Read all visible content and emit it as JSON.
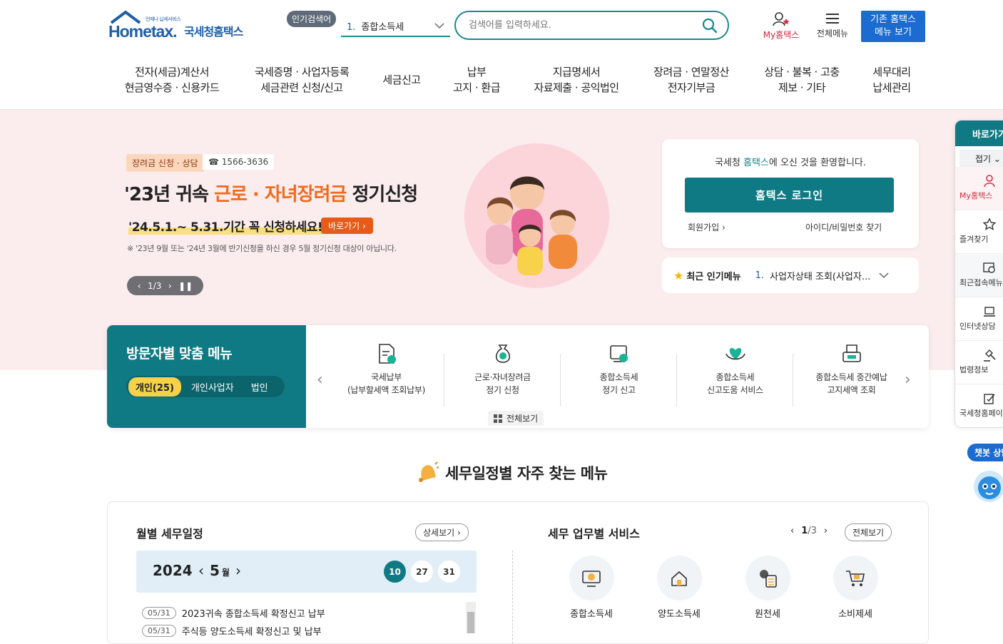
{
  "header": {
    "logo_tagline": "언제나 납세서비스",
    "logo_main": "Hometax.",
    "logo_sub": "국세청홈택스",
    "popular_badge": "인기검색어",
    "popular_rank": "1.",
    "popular_term": "종합소득세",
    "search_placeholder": "검색어를 입력하세요.",
    "my_hometax": "My홈택스",
    "all_menu": "전체메뉴",
    "legacy_line1": "기존 홈택스",
    "legacy_line2": "메뉴 보기"
  },
  "gnb": [
    {
      "l1": "전자(세금)계산서",
      "l2": "현금영수증 · 신용카드"
    },
    {
      "l1": "국세증명 · 사업자등록",
      "l2": "세금관련 신청/신고"
    },
    {
      "l1": "세금신고",
      "l2": ""
    },
    {
      "l1": "납부",
      "l2": "고지 · 환급"
    },
    {
      "l1": "지급명세서",
      "l2": "자료제출 · 공익법인"
    },
    {
      "l1": "장려금 · 연말정산",
      "l2": "전자기부금"
    },
    {
      "l1": "상담 · 불복 · 고충",
      "l2": "제보 · 기타"
    },
    {
      "l1": "세무대리",
      "l2": "납세관리"
    }
  ],
  "hero": {
    "tag": "장려금 신청 · 상담",
    "phone": "☎ 1566-3636",
    "title_pre": "'23년 귀속 ",
    "title_hl": "근로 · 자녀장려금",
    "title_post": " 정기신청",
    "date_text": "'24.5.1.~ 5.31.기간 꼭 신청하세요!",
    "go_label": "바로가기",
    "note": "※ '23년 9월 또는 '24년 3월에 반기신청을 하신 경우 5월 정기신청 대상이 아닙니다.",
    "pager": "1/3"
  },
  "login": {
    "welcome_pre": "국세청 ",
    "welcome_acc": "홈택스",
    "welcome_post": "에 오신 것을 환영합니다.",
    "login_label": "홈택스 로그인",
    "join_label": "회원가입",
    "find_label": "아이디/비밀번호 찾기"
  },
  "recent": {
    "label": "최근 인기메뉴",
    "rank": "1.",
    "item": "사업자상태 조회(사업자..."
  },
  "visitor": {
    "title": "방문자별 맞춤 메뉴",
    "tabs": [
      "개인(25)",
      "개인사업자",
      "법인"
    ],
    "items": [
      {
        "l1": "국세납부",
        "l2": "(납부할세액 조회납부)"
      },
      {
        "l1": "근로·자녀장려금",
        "l2": "정기 신청"
      },
      {
        "l1": "종합소득세",
        "l2": "정기 신고"
      },
      {
        "l1": "종합소득세",
        "l2": "신고도움 서비스"
      },
      {
        "l1": "종합소득세 중간예납",
        "l2": "고지세액 조회"
      }
    ],
    "view_all": "전체보기"
  },
  "schedule": {
    "heading": "세무일정별 자주 찾는 메뉴",
    "month_title": "월별 세무일정",
    "detail_label": "상세보기",
    "year": "2024",
    "month": "5",
    "month_unit": "월",
    "days": [
      "10",
      "27",
      "31"
    ],
    "events": [
      {
        "date": "05/31",
        "text": "2023귀속 종합소득세 확정신고 납부"
      },
      {
        "date": "05/31",
        "text": "주식등 양도소득세 확정신고 및 납부"
      }
    ]
  },
  "services": {
    "title": "세무 업무별 서비스",
    "page": "1",
    "total": "/3",
    "all_label": "전체보기",
    "items": [
      "종합소득세",
      "양도소득세",
      "원천세",
      "소비제세"
    ]
  },
  "quickbar": {
    "title": "바로가기",
    "fold": "접기",
    "items": [
      "My홈택스",
      "즐겨찾기",
      "최근접속메뉴",
      "인터넷상담",
      "법령정보",
      "국세청홈페이지"
    ]
  },
  "chatbot_label": "챗봇 상담"
}
